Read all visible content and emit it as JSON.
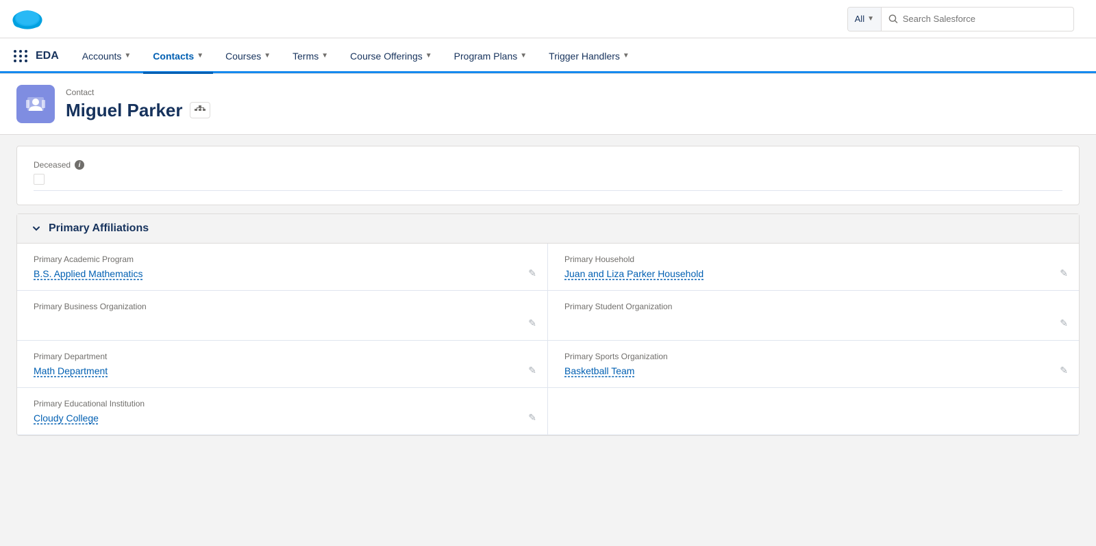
{
  "topbar": {
    "search_placeholder": "Search Salesforce",
    "search_all_label": "All"
  },
  "nav": {
    "app_name": "EDA",
    "items": [
      {
        "label": "Accounts",
        "active": false
      },
      {
        "label": "Contacts",
        "active": true
      },
      {
        "label": "Courses",
        "active": false
      },
      {
        "label": "Terms",
        "active": false
      },
      {
        "label": "Course Offerings",
        "active": false
      },
      {
        "label": "Program Plans",
        "active": false
      },
      {
        "label": "Trigger Handlers",
        "active": false
      }
    ]
  },
  "page_header": {
    "breadcrumb": "Contact",
    "title": "Miguel Parker"
  },
  "deceased_section": {
    "label": "Deceased"
  },
  "primary_affiliations": {
    "section_title": "Primary Affiliations",
    "fields": [
      {
        "label": "Primary Academic Program",
        "value": "B.S. Applied Mathematics",
        "is_link": true,
        "side": "left"
      },
      {
        "label": "Primary Household",
        "value": "Juan and Liza Parker Household",
        "is_link": true,
        "side": "right"
      },
      {
        "label": "Primary Business Organization",
        "value": "",
        "is_link": false,
        "side": "left"
      },
      {
        "label": "Primary Student Organization",
        "value": "",
        "is_link": false,
        "side": "right"
      },
      {
        "label": "Primary Department",
        "value": "Math Department",
        "is_link": true,
        "side": "left"
      },
      {
        "label": "Primary Sports Organization",
        "value": "Basketball Team",
        "is_link": true,
        "side": "right"
      },
      {
        "label": "Primary Educational Institution",
        "value": "Cloudy College",
        "is_link": true,
        "side": "left"
      },
      {
        "label": "",
        "value": "",
        "is_link": false,
        "side": "right",
        "empty_right": true
      }
    ]
  },
  "colors": {
    "accent_blue": "#005fb2",
    "nav_active": "#005fb2",
    "logo_bg": "#7f8de1"
  }
}
